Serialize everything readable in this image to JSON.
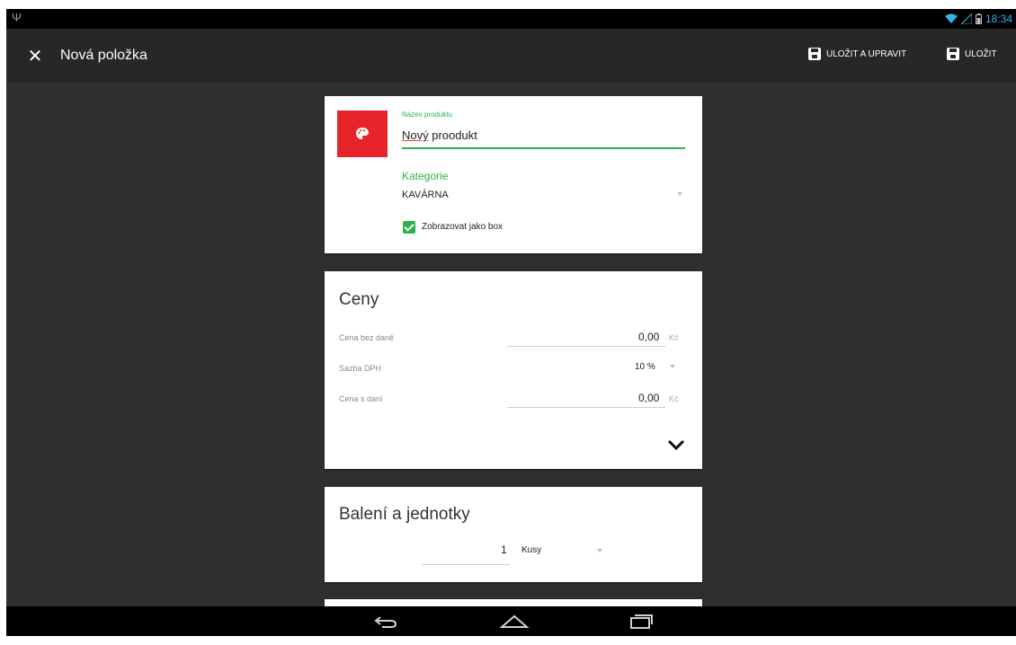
{
  "status_bar": {
    "time": "18:34",
    "icons": [
      "usb-icon",
      "wifi-icon",
      "signal-icon",
      "battery-icon"
    ],
    "accent_color": "#33b5e5"
  },
  "action_bar": {
    "title": "Nová položka",
    "close_icon": "close-icon",
    "save_edit_label": "ULOŽIT A UPRAVIT",
    "save_label": "ULOŽIT"
  },
  "product": {
    "name_label": "Název produktu",
    "name_value_word1": "Nový",
    "name_value_rest": " proodukt",
    "category_label": "Kategorie",
    "category_value": "KAVÁRNA",
    "checkbox_label": "Zobrazovat jako box",
    "checkbox_checked": true,
    "icon_color": "#e8242b",
    "accent_color": "#2bb24c"
  },
  "prices": {
    "title": "Ceny",
    "rows": [
      {
        "label": "Cena bez daně",
        "value": "0,00",
        "unit": "Kč"
      },
      {
        "label": "Sazba DPH",
        "value": "10 %",
        "unit": ""
      },
      {
        "label": "Cena s daní",
        "value": "0,00",
        "unit": "Kč"
      }
    ]
  },
  "packaging": {
    "title": "Balení a jednotky",
    "quantity": "1",
    "unit": "Kusy"
  }
}
